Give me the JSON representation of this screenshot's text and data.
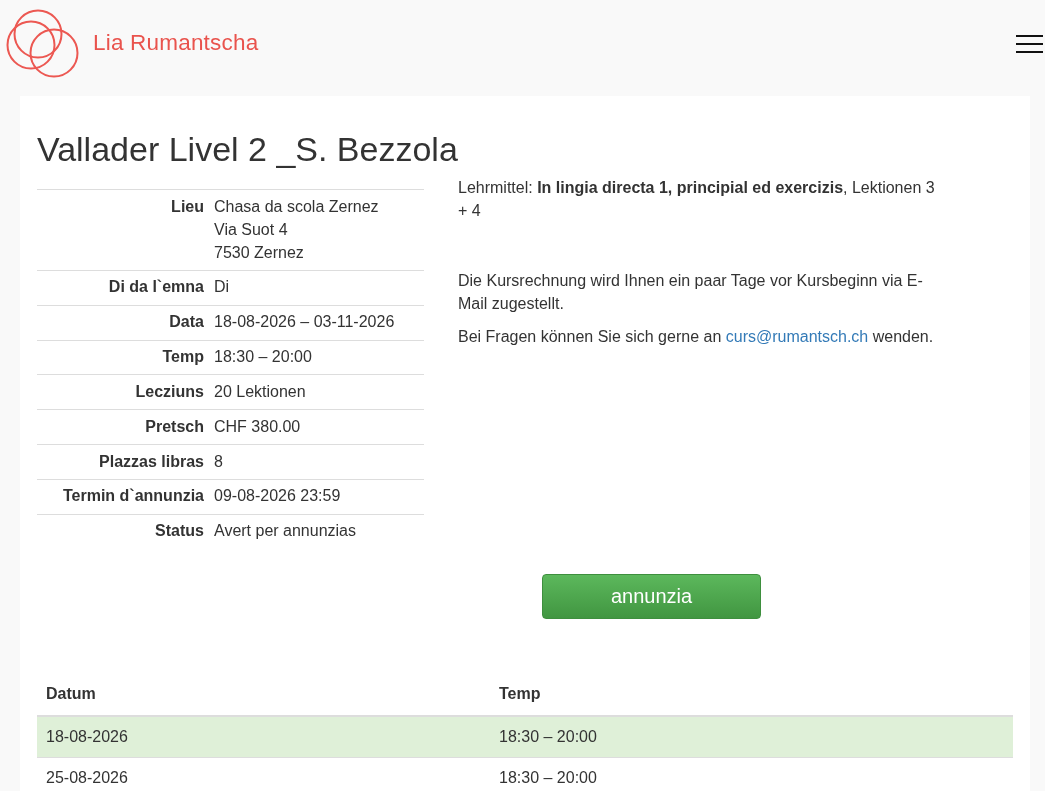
{
  "header": {
    "site_name": "Lia Rumantscha"
  },
  "course": {
    "title": "Vallader Livel 2 _S. Bezzola",
    "details": [
      {
        "label": "Lieu",
        "lines": [
          "Chasa da scola Zernez",
          "Via Suot 4",
          "7530 Zernez"
        ]
      },
      {
        "label": "Di da l`emna",
        "lines": [
          "Di"
        ]
      },
      {
        "label": "Data",
        "lines": [
          "18-08-2026 – 03-11-2026"
        ]
      },
      {
        "label": "Temp",
        "lines": [
          "18:30 – 20:00"
        ]
      },
      {
        "label": "Lecziuns",
        "lines": [
          "20 Lektionen"
        ]
      },
      {
        "label": "Pretsch",
        "lines": [
          "CHF 380.00"
        ]
      },
      {
        "label": "Plazzas libras",
        "lines": [
          "8"
        ]
      },
      {
        "label": "Termin d`annunzia",
        "lines": [
          "09-08-2026 23:59"
        ]
      },
      {
        "label": "Status",
        "lines": [
          "Avert per annunzias"
        ]
      }
    ],
    "teaching_material": "Lehrmittel: **In lingia directa 1, principial ed exercizis**, Lektionen 3 + 4",
    "invoice_note": "Die Kursrechnung wird Ihnen ein paar Tage vor Kursbeginn via E-Mail zugestellt.",
    "contact": {
      "before": "Bei Fragen können Sie sich gerne an ",
      "link": "curs@rumantsch.ch",
      "after": " wenden."
    },
    "register_button": "annunzia"
  },
  "schedule": {
    "columns": [
      "Datum",
      "Temp"
    ],
    "rows": [
      {
        "cells": [
          "18-08-2026",
          "18:30 – 20:00"
        ],
        "highlighted": true
      },
      {
        "cells": [
          "25-08-2026",
          "18:30 – 20:00"
        ],
        "highlighted": false
      }
    ]
  }
}
